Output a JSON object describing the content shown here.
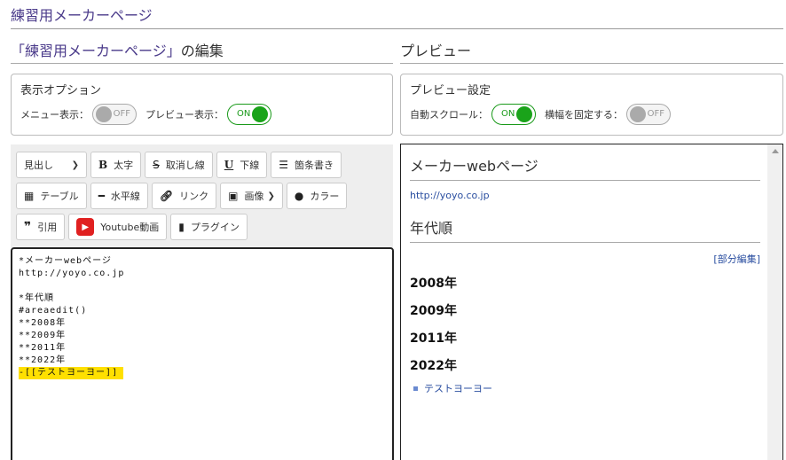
{
  "page_title": "練習用メーカーページ",
  "edit_title": {
    "open_quote": "「",
    "name": "練習用メーカーページ",
    "close_quote": "」",
    "suffix": "の編集"
  },
  "preview_title": "プレビュー",
  "display_options": {
    "heading": "表示オプション",
    "menu_label": "メニュー表示：",
    "menu_state": "OFF",
    "preview_label": "プレビュー表示：",
    "preview_state": "ON"
  },
  "preview_settings": {
    "heading": "プレビュー設定",
    "autoscroll_label": "自動スクロール：",
    "autoscroll_state": "ON",
    "fixwidth_label": "横幅を固定する：",
    "fixwidth_state": "OFF"
  },
  "toolbar": {
    "heading_select": "見出し",
    "bold": "太字",
    "strike": "取消し線",
    "underline": "下線",
    "list": "箇条書き",
    "table": "テーブル",
    "hr": "水平線",
    "link": "リンク",
    "image": "画像",
    "color": "カラー",
    "quote": "引用",
    "youtube": "Youtube動画",
    "plugin": "プラグイン"
  },
  "editor_lines": [
    "*メーカーwebページ",
    "http://yoyo.co.jp",
    "",
    "*年代順",
    "#areaedit()",
    "**2008年",
    "**2009年",
    "**2011年",
    "**2022年",
    "-[[テストヨーヨー]]"
  ],
  "preview": {
    "h2": "メーカーwebページ",
    "link": "http://yoyo.co.jp",
    "h3": "年代順",
    "edit_link": "[部分編集]",
    "years": [
      "2008年",
      "2009年",
      "2011年",
      "2022年"
    ],
    "item": "テストヨーヨー"
  }
}
